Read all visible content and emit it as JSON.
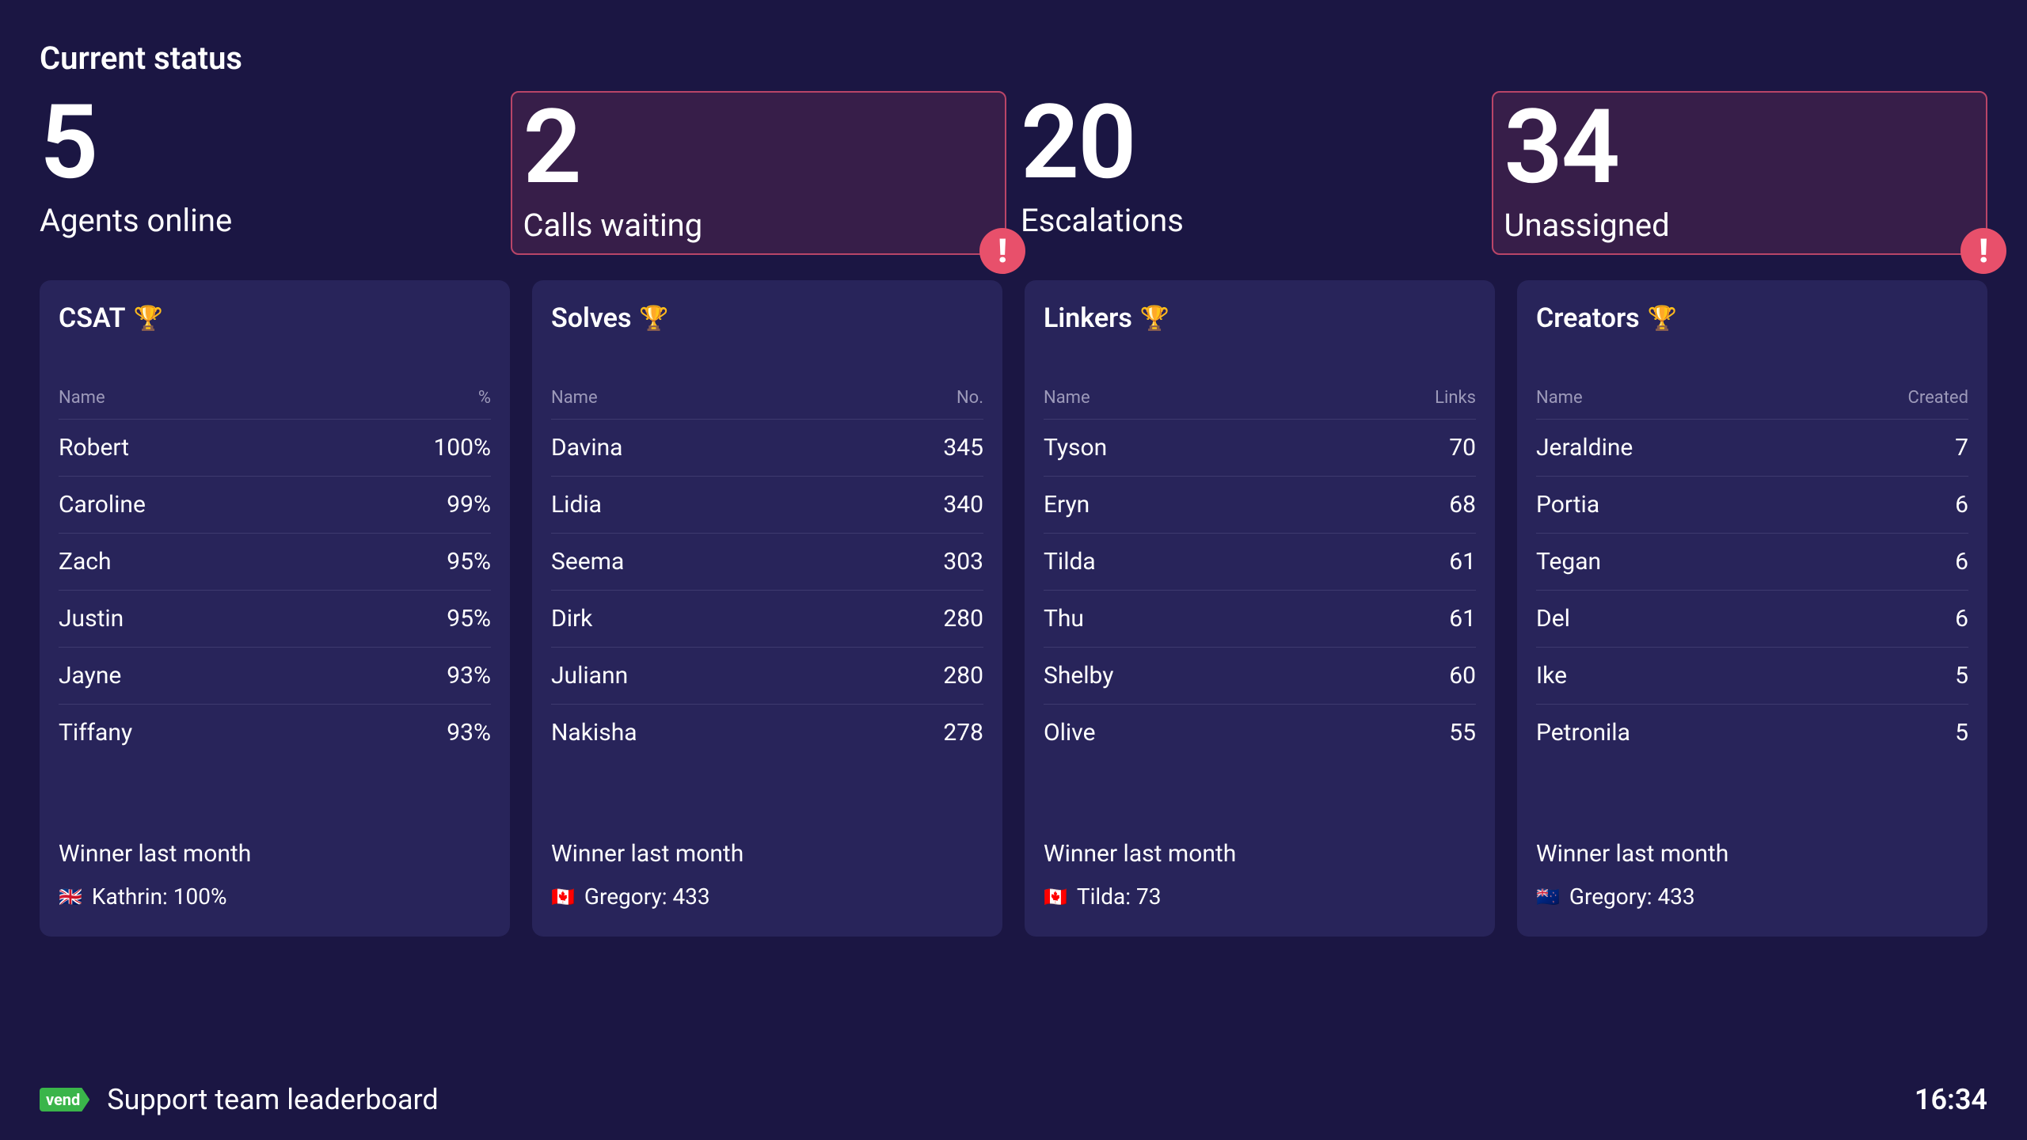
{
  "status": {
    "header": "Current status",
    "cells": [
      {
        "value": "5",
        "label": "Agents online",
        "alert": false
      },
      {
        "value": "2",
        "label": "Calls waiting",
        "alert": true
      },
      {
        "value": "20",
        "label": "Escalations",
        "alert": false
      },
      {
        "value": "34",
        "label": "Unassigned",
        "alert": true
      }
    ]
  },
  "cards": [
    {
      "title": "CSAT",
      "col_name": "Name",
      "col_value": "%",
      "rows": [
        {
          "name": "Robert",
          "value": "100%"
        },
        {
          "name": "Caroline",
          "value": "99%"
        },
        {
          "name": "Zach",
          "value": "95%"
        },
        {
          "name": "Justin",
          "value": "95%"
        },
        {
          "name": "Jayne",
          "value": "93%"
        },
        {
          "name": "Tiffany",
          "value": "93%"
        }
      ],
      "winner_label": "Winner last month",
      "winner_flag": "🇬🇧",
      "winner_text": "Kathrin: 100%"
    },
    {
      "title": "Solves",
      "col_name": "Name",
      "col_value": "No.",
      "rows": [
        {
          "name": "Davina",
          "value": "345"
        },
        {
          "name": "Lidia",
          "value": "340"
        },
        {
          "name": "Seema",
          "value": "303"
        },
        {
          "name": "Dirk",
          "value": "280"
        },
        {
          "name": "Juliann",
          "value": "280"
        },
        {
          "name": "Nakisha",
          "value": "278"
        }
      ],
      "winner_label": "Winner last month",
      "winner_flag": "🇨🇦",
      "winner_text": "Gregory: 433"
    },
    {
      "title": "Linkers",
      "col_name": "Name",
      "col_value": "Links",
      "rows": [
        {
          "name": "Tyson",
          "value": "70"
        },
        {
          "name": "Eryn",
          "value": "68"
        },
        {
          "name": "Tilda",
          "value": "61"
        },
        {
          "name": "Thu",
          "value": "61"
        },
        {
          "name": "Shelby",
          "value": "60"
        },
        {
          "name": "Olive",
          "value": "55"
        }
      ],
      "winner_label": "Winner last month",
      "winner_flag": "🇨🇦",
      "winner_text": "Tilda: 73"
    },
    {
      "title": "Creators",
      "col_name": "Name",
      "col_value": "Created",
      "rows": [
        {
          "name": "Jeraldine",
          "value": "7"
        },
        {
          "name": "Portia",
          "value": "6"
        },
        {
          "name": "Tegan",
          "value": "6"
        },
        {
          "name": "Del",
          "value": "6"
        },
        {
          "name": "Ike",
          "value": "5"
        },
        {
          "name": "Petronila",
          "value": "5"
        }
      ],
      "winner_label": "Winner last month",
      "winner_flag": "🇳🇿",
      "winner_text": "Gregory: 433"
    }
  ],
  "footer": {
    "brand": "vend",
    "title": "Support team leaderboard",
    "time": "16:34"
  },
  "icons": {
    "trophy": "🏆",
    "alert": "!"
  }
}
